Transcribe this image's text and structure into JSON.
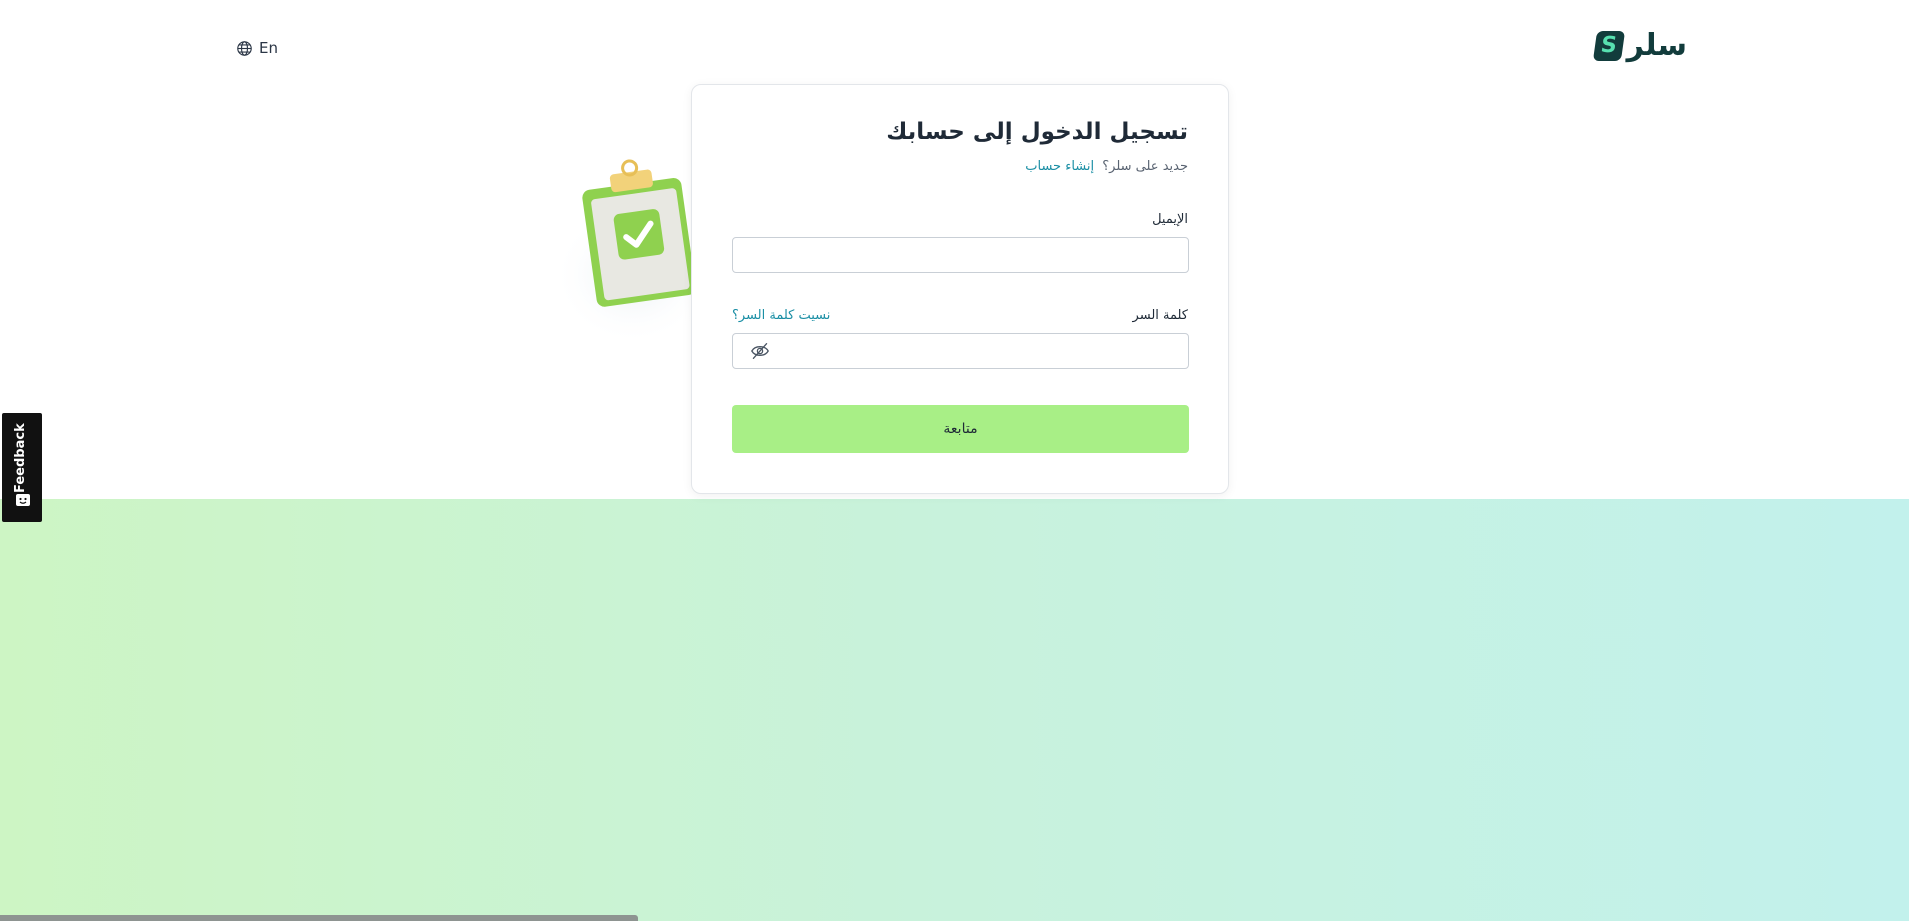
{
  "header": {
    "language_label": "En",
    "logo_text": "سلر",
    "logo_mark": "S"
  },
  "login": {
    "title": "تسجيل الدخول إلى حسابك",
    "new_user_text": "جديد على سلر؟",
    "create_account_link": "إنشاء حساب",
    "email_label": "الإيميل",
    "email_value": "",
    "password_label": "كلمة السر",
    "password_value": "",
    "forgot_password_link": "نسيت كلمة السر؟",
    "submit_label": "متابعة"
  },
  "feedback": {
    "label": "Feedback"
  },
  "icons": {
    "language": "globe-icon",
    "password_toggle": "eye-off-icon",
    "feedback": "smiley-icon",
    "illustration": "clipboard-check-illustration"
  },
  "colors": {
    "brand_dark": "#123c3c",
    "brand_accent": "#57e0b0",
    "link": "#1b8fa5",
    "button": "#a8ef86",
    "gradient_start": "#cdf5c4",
    "gradient_end": "#c2f1ec"
  }
}
